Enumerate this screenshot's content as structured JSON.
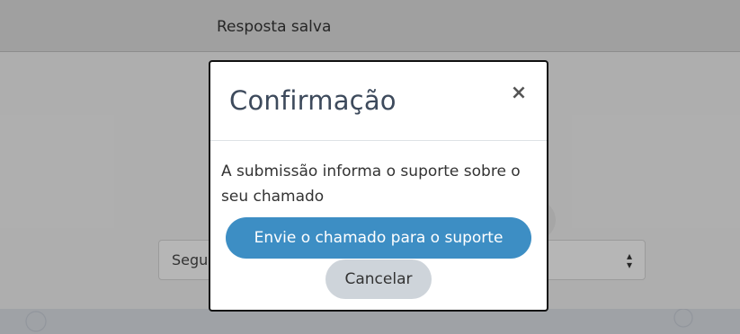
{
  "background": {
    "header_text": "Resposta salva",
    "select_visible_text": "Segu"
  },
  "modal": {
    "title": "Confirmação",
    "close_symbol": "×",
    "message": "A submissão informa o suporte sobre o seu chamado",
    "primary_button": "Envie o chamado para o suporte",
    "cancel_button": "Cancelar"
  },
  "colors": {
    "primary": "#3d8ec4",
    "secondary": "#ced4da",
    "title": "#3d4a5c"
  },
  "icons": {
    "close": "close-icon",
    "select_caret": "sort-caret-icon"
  }
}
